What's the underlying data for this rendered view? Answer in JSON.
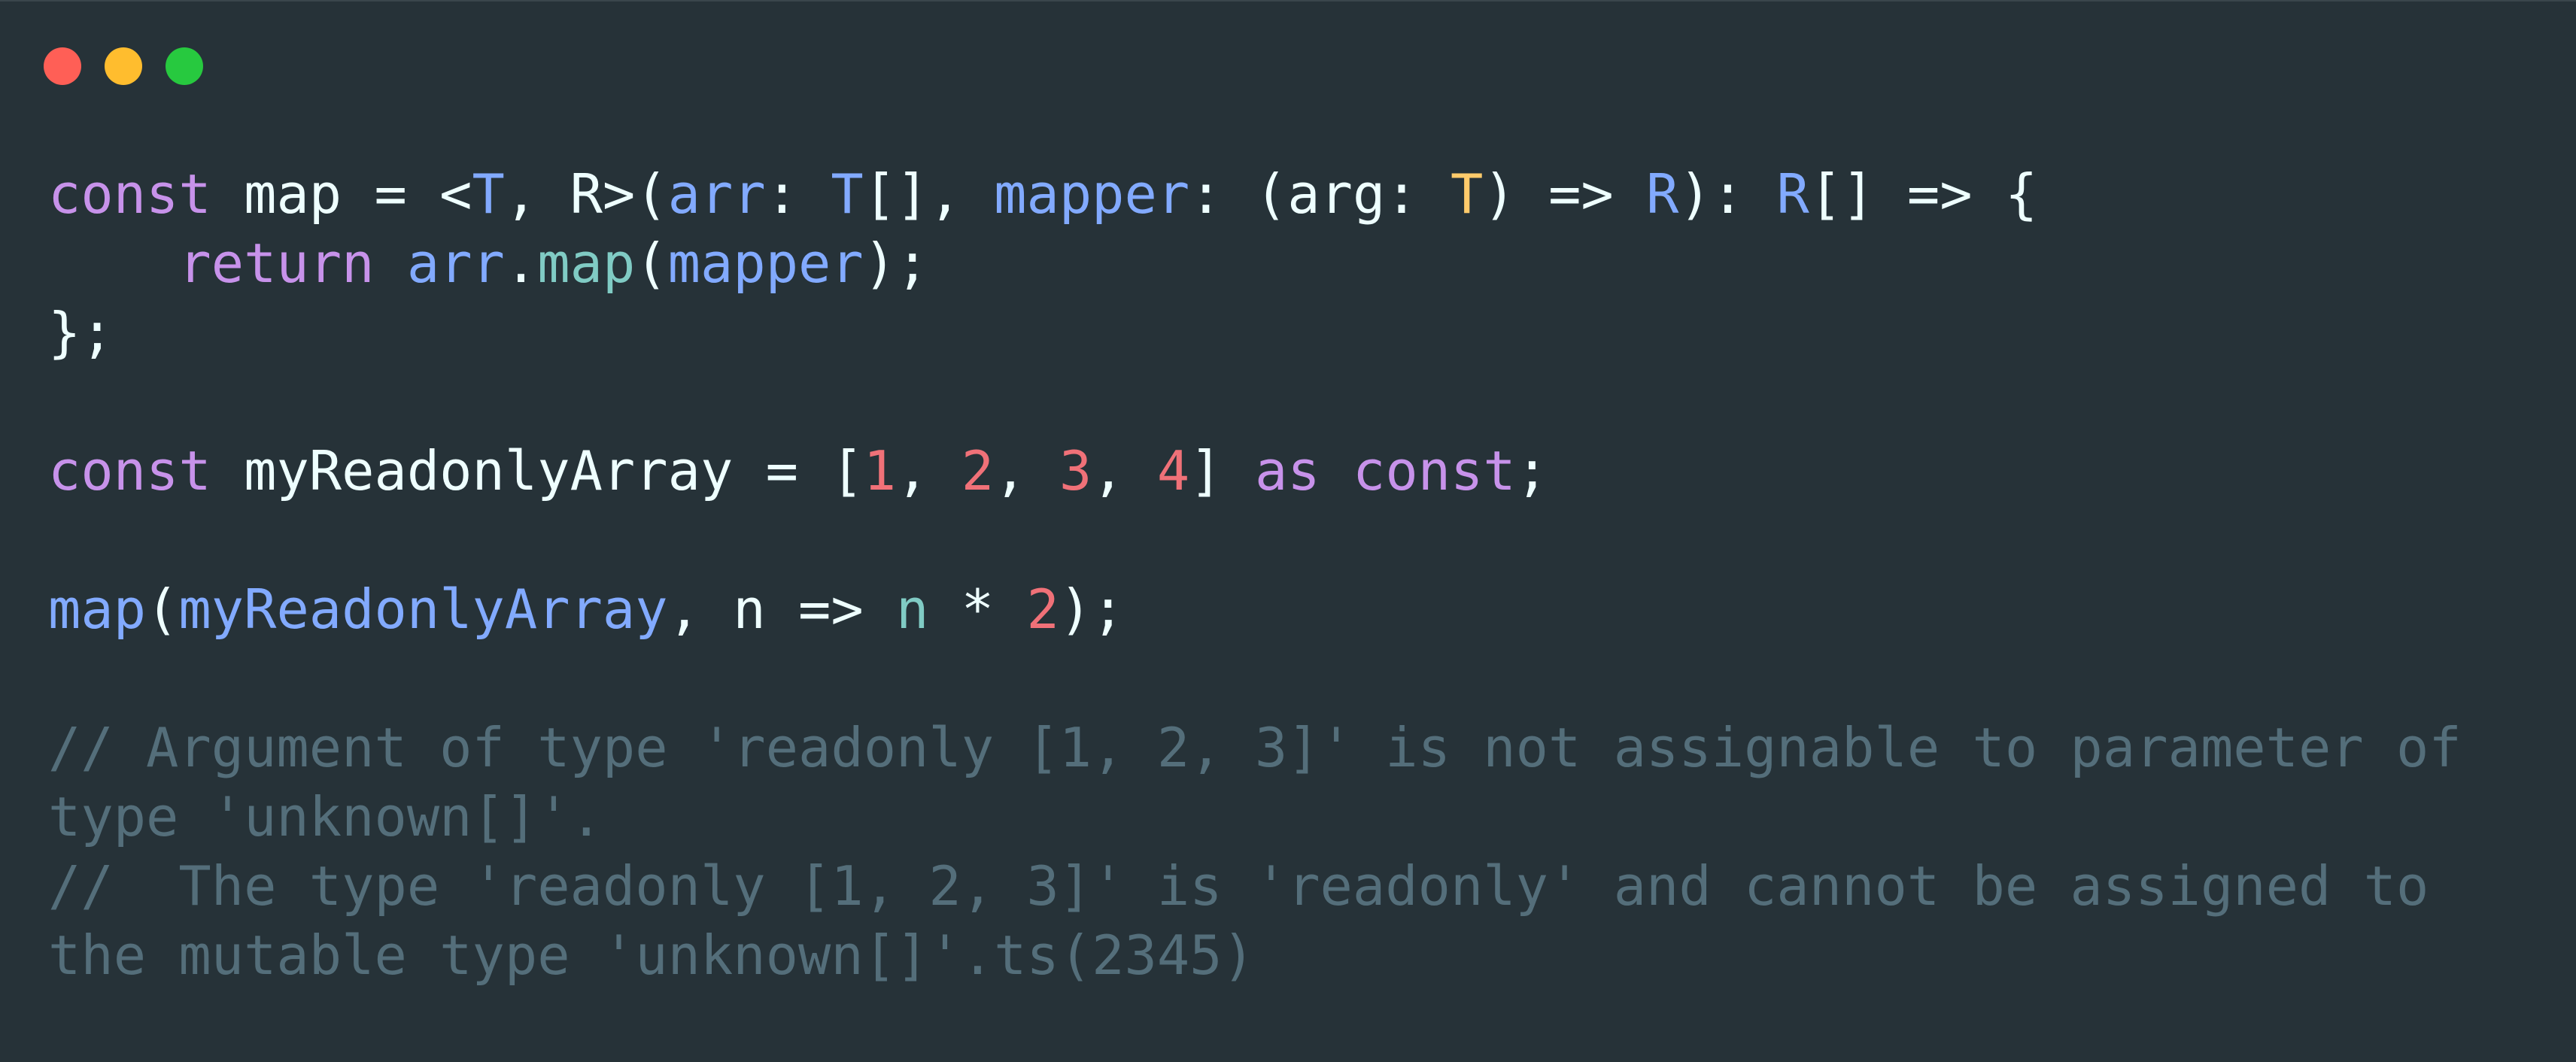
{
  "window": {
    "controls": {
      "close_color": "#ff5f56",
      "minimize_color": "#ffbd2e",
      "maximize_color": "#27c93f"
    },
    "background_color": "#263238"
  },
  "code": {
    "language": "typescript",
    "lines": [
      [
        {
          "t": "const",
          "c": "kw"
        },
        {
          "t": " map = <",
          "c": "plain"
        },
        {
          "t": "T",
          "c": "id"
        },
        {
          "t": ", R>(",
          "c": "plain"
        },
        {
          "t": "arr",
          "c": "id"
        },
        {
          "t": ": ",
          "c": "plain"
        },
        {
          "t": "T",
          "c": "id"
        },
        {
          "t": "[], ",
          "c": "plain"
        },
        {
          "t": "mapper",
          "c": "id"
        },
        {
          "t": ": (arg: ",
          "c": "plain"
        },
        {
          "t": "T",
          "c": "gen"
        },
        {
          "t": ") => ",
          "c": "plain"
        },
        {
          "t": "R",
          "c": "id"
        },
        {
          "t": "): ",
          "c": "plain"
        },
        {
          "t": "R",
          "c": "id"
        },
        {
          "t": "[] => {",
          "c": "plain"
        }
      ],
      [
        {
          "t": "    ",
          "c": "plain"
        },
        {
          "t": "return",
          "c": "kw"
        },
        {
          "t": " ",
          "c": "plain"
        },
        {
          "t": "arr",
          "c": "id"
        },
        {
          "t": ".",
          "c": "plain"
        },
        {
          "t": "map",
          "c": "fn"
        },
        {
          "t": "(",
          "c": "plain"
        },
        {
          "t": "mapper",
          "c": "id"
        },
        {
          "t": ");",
          "c": "plain"
        }
      ],
      [
        {
          "t": "};",
          "c": "plain"
        }
      ],
      [],
      [
        {
          "t": "const",
          "c": "kw"
        },
        {
          "t": " myReadonlyArray = [",
          "c": "plain"
        },
        {
          "t": "1",
          "c": "num"
        },
        {
          "t": ", ",
          "c": "plain"
        },
        {
          "t": "2",
          "c": "num"
        },
        {
          "t": ", ",
          "c": "plain"
        },
        {
          "t": "3",
          "c": "num"
        },
        {
          "t": ", ",
          "c": "plain"
        },
        {
          "t": "4",
          "c": "num"
        },
        {
          "t": "] ",
          "c": "plain"
        },
        {
          "t": "as",
          "c": "kw"
        },
        {
          "t": " ",
          "c": "plain"
        },
        {
          "t": "const",
          "c": "kw"
        },
        {
          "t": ";",
          "c": "plain"
        }
      ],
      [],
      [
        {
          "t": "map",
          "c": "id"
        },
        {
          "t": "(",
          "c": "plain"
        },
        {
          "t": "myReadonlyArray",
          "c": "id"
        },
        {
          "t": ", n => ",
          "c": "plain"
        },
        {
          "t": "n",
          "c": "param"
        },
        {
          "t": " * ",
          "c": "plain"
        },
        {
          "t": "2",
          "c": "num"
        },
        {
          "t": ");",
          "c": "plain"
        }
      ],
      [],
      [
        {
          "t": "// Argument of type 'readonly [1, 2, 3]' is not assignable to parameter of",
          "c": "cm"
        }
      ],
      [
        {
          "t": "type 'unknown[]'.",
          "c": "cm"
        }
      ],
      [
        {
          "t": "//  The type 'readonly [1, 2, 3]' is 'readonly' and cannot be assigned to",
          "c": "cm"
        }
      ],
      [
        {
          "t": "the mutable type 'unknown[]'.ts(2345)",
          "c": "cm"
        }
      ]
    ]
  }
}
